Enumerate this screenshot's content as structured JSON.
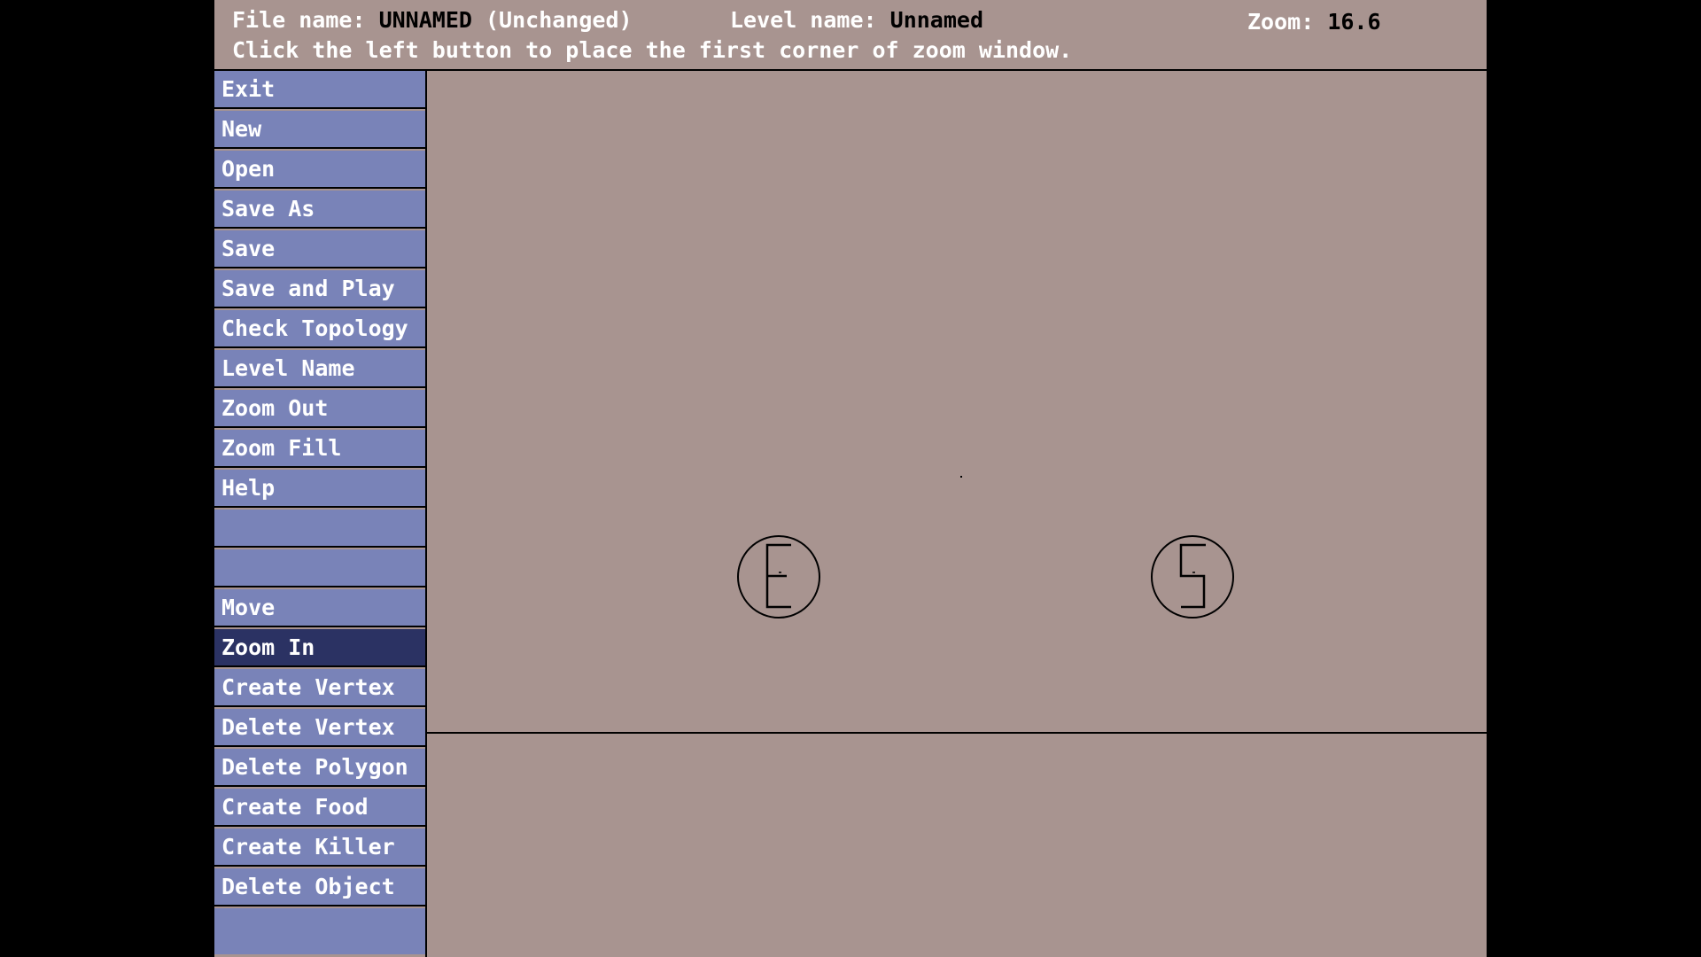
{
  "header": {
    "file_label": "File name:",
    "file_value": "UNNAMED",
    "file_state": "(Unchanged)",
    "level_label": "Level name:",
    "level_value": "Unnamed",
    "zoom_label": "Zoom:",
    "zoom_value": "16.6",
    "status_message": "Click the left button to place the first corner of zoom window."
  },
  "menu": {
    "items": [
      {
        "label": "Exit"
      },
      {
        "label": "New"
      },
      {
        "label": "Open"
      },
      {
        "label": "Save As"
      },
      {
        "label": "Save"
      },
      {
        "label": "Save and Play"
      },
      {
        "label": "Check Topology"
      },
      {
        "label": "Level Name"
      },
      {
        "label": "Zoom Out"
      },
      {
        "label": "Zoom Fill"
      },
      {
        "label": "Help"
      },
      {
        "label": ""
      },
      {
        "label": ""
      },
      {
        "label": "Move"
      },
      {
        "label": "Zoom In"
      },
      {
        "label": "Create Vertex"
      },
      {
        "label": "Delete Vertex"
      },
      {
        "label": "Delete Polygon"
      },
      {
        "label": "Create Food"
      },
      {
        "label": "Create Killer"
      },
      {
        "label": "Delete Object"
      },
      {
        "label": ""
      }
    ],
    "active_label": "Zoom In"
  },
  "canvas": {
    "objects": [
      {
        "name": "exit-flower",
        "letter": "E"
      },
      {
        "name": "start-object",
        "letter": "S"
      }
    ]
  },
  "colors": {
    "background": "#a89490",
    "menu_button": "#7983b8",
    "menu_button_active": "#2b3263",
    "outer": "#000000"
  }
}
